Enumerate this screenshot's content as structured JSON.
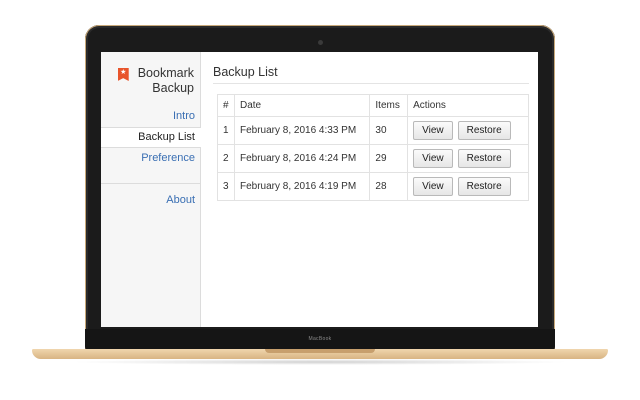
{
  "device": {
    "brand_text": "MacBook"
  },
  "sidebar": {
    "logo": {
      "line1": "Bookmark",
      "line2": "Backup",
      "icon": "star-bookmark-icon",
      "icon_color": "#e8542b"
    },
    "items": [
      {
        "label": "Intro",
        "active": false
      },
      {
        "label": "Backup List",
        "active": true
      },
      {
        "label": "Preference",
        "active": false
      },
      {
        "label": "About",
        "active": false
      }
    ]
  },
  "main": {
    "title": "Backup List",
    "table": {
      "headers": [
        "#",
        "Date",
        "Items",
        "Actions"
      ],
      "rows": [
        {
          "num": "1",
          "date": "February 8, 2016 4:33 PM",
          "items": "30",
          "view_label": "View",
          "restore_label": "Restore"
        },
        {
          "num": "2",
          "date": "February 8, 2016 4:24 PM",
          "items": "29",
          "view_label": "View",
          "restore_label": "Restore"
        },
        {
          "num": "3",
          "date": "February 8, 2016 4:19 PM",
          "items": "28",
          "view_label": "View",
          "restore_label": "Restore"
        }
      ]
    }
  },
  "colors": {
    "link": "#3a6fb3",
    "accent": "#e8542b",
    "frame_gold": "#d8b483"
  }
}
